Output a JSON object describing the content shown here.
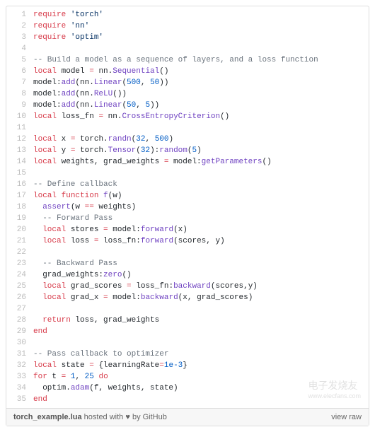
{
  "filename": "torch_example.lua",
  "footer_hosted": " hosted with ",
  "footer_heart": "♥",
  "footer_by": " by ",
  "footer_github": "GitHub",
  "footer_viewraw": "view raw",
  "watermark1": "电子发烧友",
  "watermark2": "www.elecfans.com",
  "lines": [
    {
      "n": 1,
      "tokens": [
        [
          "kw",
          "require"
        ],
        [
          "plain",
          " "
        ],
        [
          "str",
          "'torch'"
        ]
      ]
    },
    {
      "n": 2,
      "tokens": [
        [
          "kw",
          "require"
        ],
        [
          "plain",
          " "
        ],
        [
          "str",
          "'nn'"
        ]
      ]
    },
    {
      "n": 3,
      "tokens": [
        [
          "kw",
          "require"
        ],
        [
          "plain",
          " "
        ],
        [
          "str",
          "'optim'"
        ]
      ]
    },
    {
      "n": 4,
      "tokens": []
    },
    {
      "n": 5,
      "tokens": [
        [
          "cm",
          "-- Build a model as a sequence of layers, and a loss function"
        ]
      ]
    },
    {
      "n": 6,
      "tokens": [
        [
          "kw",
          "local"
        ],
        [
          "plain",
          " model "
        ],
        [
          "kw",
          "="
        ],
        [
          "plain",
          " nn."
        ],
        [
          "fn",
          "Sequential"
        ],
        [
          "plain",
          "()"
        ]
      ]
    },
    {
      "n": 7,
      "tokens": [
        [
          "plain",
          "model:"
        ],
        [
          "fn",
          "add"
        ],
        [
          "plain",
          "(nn."
        ],
        [
          "fn",
          "Linear"
        ],
        [
          "plain",
          "("
        ],
        [
          "num",
          "500"
        ],
        [
          "plain",
          ", "
        ],
        [
          "num",
          "50"
        ],
        [
          "plain",
          "))"
        ]
      ]
    },
    {
      "n": 8,
      "tokens": [
        [
          "plain",
          "model:"
        ],
        [
          "fn",
          "add"
        ],
        [
          "plain",
          "(nn."
        ],
        [
          "fn",
          "ReLU"
        ],
        [
          "plain",
          "())"
        ]
      ]
    },
    {
      "n": 9,
      "tokens": [
        [
          "plain",
          "model:"
        ],
        [
          "fn",
          "add"
        ],
        [
          "plain",
          "(nn."
        ],
        [
          "fn",
          "Linear"
        ],
        [
          "plain",
          "("
        ],
        [
          "num",
          "50"
        ],
        [
          "plain",
          ", "
        ],
        [
          "num",
          "5"
        ],
        [
          "plain",
          "))"
        ]
      ]
    },
    {
      "n": 10,
      "tokens": [
        [
          "kw",
          "local"
        ],
        [
          "plain",
          " loss_fn "
        ],
        [
          "kw",
          "="
        ],
        [
          "plain",
          " nn."
        ],
        [
          "fn",
          "CrossEntropyCriterion"
        ],
        [
          "plain",
          "()"
        ]
      ]
    },
    {
      "n": 11,
      "tokens": []
    },
    {
      "n": 12,
      "tokens": [
        [
          "kw",
          "local"
        ],
        [
          "plain",
          " x "
        ],
        [
          "kw",
          "="
        ],
        [
          "plain",
          " torch."
        ],
        [
          "fn",
          "randn"
        ],
        [
          "plain",
          "("
        ],
        [
          "num",
          "32"
        ],
        [
          "plain",
          ", "
        ],
        [
          "num",
          "500"
        ],
        [
          "plain",
          ")"
        ]
      ]
    },
    {
      "n": 13,
      "tokens": [
        [
          "kw",
          "local"
        ],
        [
          "plain",
          " y "
        ],
        [
          "kw",
          "="
        ],
        [
          "plain",
          " torch."
        ],
        [
          "fn",
          "Tensor"
        ],
        [
          "plain",
          "("
        ],
        [
          "num",
          "32"
        ],
        [
          "plain",
          "):"
        ],
        [
          "fn",
          "random"
        ],
        [
          "plain",
          "("
        ],
        [
          "num",
          "5"
        ],
        [
          "plain",
          ")"
        ]
      ]
    },
    {
      "n": 14,
      "tokens": [
        [
          "kw",
          "local"
        ],
        [
          "plain",
          " weights, grad_weights "
        ],
        [
          "kw",
          "="
        ],
        [
          "plain",
          " model:"
        ],
        [
          "fn",
          "getParameters"
        ],
        [
          "plain",
          "()"
        ]
      ]
    },
    {
      "n": 15,
      "tokens": []
    },
    {
      "n": 16,
      "tokens": [
        [
          "cm",
          "-- Define callback"
        ]
      ]
    },
    {
      "n": 17,
      "tokens": [
        [
          "kw",
          "local"
        ],
        [
          "plain",
          " "
        ],
        [
          "kw",
          "function"
        ],
        [
          "plain",
          " "
        ],
        [
          "fn",
          "f"
        ],
        [
          "plain",
          "(w)"
        ]
      ]
    },
    {
      "n": 18,
      "tokens": [
        [
          "plain",
          "  "
        ],
        [
          "fn",
          "assert"
        ],
        [
          "plain",
          "(w "
        ],
        [
          "kw",
          "=="
        ],
        [
          "plain",
          " weights)"
        ]
      ]
    },
    {
      "n": 19,
      "tokens": [
        [
          "plain",
          "  "
        ],
        [
          "cm",
          "-- Forward Pass"
        ]
      ]
    },
    {
      "n": 20,
      "tokens": [
        [
          "plain",
          "  "
        ],
        [
          "kw",
          "local"
        ],
        [
          "plain",
          " stores "
        ],
        [
          "kw",
          "="
        ],
        [
          "plain",
          " model:"
        ],
        [
          "fn",
          "forward"
        ],
        [
          "plain",
          "(x)"
        ]
      ]
    },
    {
      "n": 21,
      "tokens": [
        [
          "plain",
          "  "
        ],
        [
          "kw",
          "local"
        ],
        [
          "plain",
          " loss "
        ],
        [
          "kw",
          "="
        ],
        [
          "plain",
          " loss_fn:"
        ],
        [
          "fn",
          "forward"
        ],
        [
          "plain",
          "(scores, y)"
        ]
      ]
    },
    {
      "n": 22,
      "tokens": []
    },
    {
      "n": 23,
      "tokens": [
        [
          "plain",
          "  "
        ],
        [
          "cm",
          "-- Backward Pass"
        ]
      ]
    },
    {
      "n": 24,
      "tokens": [
        [
          "plain",
          "  grad_weights:"
        ],
        [
          "fn",
          "zero"
        ],
        [
          "plain",
          "()"
        ]
      ]
    },
    {
      "n": 25,
      "tokens": [
        [
          "plain",
          "  "
        ],
        [
          "kw",
          "local"
        ],
        [
          "plain",
          " grad_scores "
        ],
        [
          "kw",
          "="
        ],
        [
          "plain",
          " loss_fn:"
        ],
        [
          "fn",
          "backward"
        ],
        [
          "plain",
          "(scores,y)"
        ]
      ]
    },
    {
      "n": 26,
      "tokens": [
        [
          "plain",
          "  "
        ],
        [
          "kw",
          "local"
        ],
        [
          "plain",
          " grad_x "
        ],
        [
          "kw",
          "="
        ],
        [
          "plain",
          " model:"
        ],
        [
          "fn",
          "backward"
        ],
        [
          "plain",
          "(x, grad_scores)"
        ]
      ]
    },
    {
      "n": 27,
      "tokens": []
    },
    {
      "n": 28,
      "tokens": [
        [
          "plain",
          "  "
        ],
        [
          "kw",
          "return"
        ],
        [
          "plain",
          " loss, grad_weights"
        ]
      ]
    },
    {
      "n": 29,
      "tokens": [
        [
          "kw",
          "end"
        ]
      ]
    },
    {
      "n": 30,
      "tokens": []
    },
    {
      "n": 31,
      "tokens": [
        [
          "cm",
          "-- Pass callback to optimizer"
        ]
      ]
    },
    {
      "n": 32,
      "tokens": [
        [
          "kw",
          "local"
        ],
        [
          "plain",
          " state "
        ],
        [
          "kw",
          "="
        ],
        [
          "plain",
          " {learningRate"
        ],
        [
          "kw",
          "="
        ],
        [
          "num",
          "1e-3"
        ],
        [
          "plain",
          "}"
        ]
      ]
    },
    {
      "n": 33,
      "tokens": [
        [
          "kw",
          "for"
        ],
        [
          "plain",
          " t "
        ],
        [
          "kw",
          "="
        ],
        [
          "plain",
          " "
        ],
        [
          "num",
          "1"
        ],
        [
          "plain",
          ", "
        ],
        [
          "num",
          "25"
        ],
        [
          "plain",
          " "
        ],
        [
          "kw",
          "do"
        ]
      ]
    },
    {
      "n": 34,
      "tokens": [
        [
          "plain",
          "  optim."
        ],
        [
          "fn",
          "adam"
        ],
        [
          "plain",
          "(f, weights, state)"
        ]
      ]
    },
    {
      "n": 35,
      "tokens": [
        [
          "kw",
          "end"
        ]
      ]
    }
  ]
}
